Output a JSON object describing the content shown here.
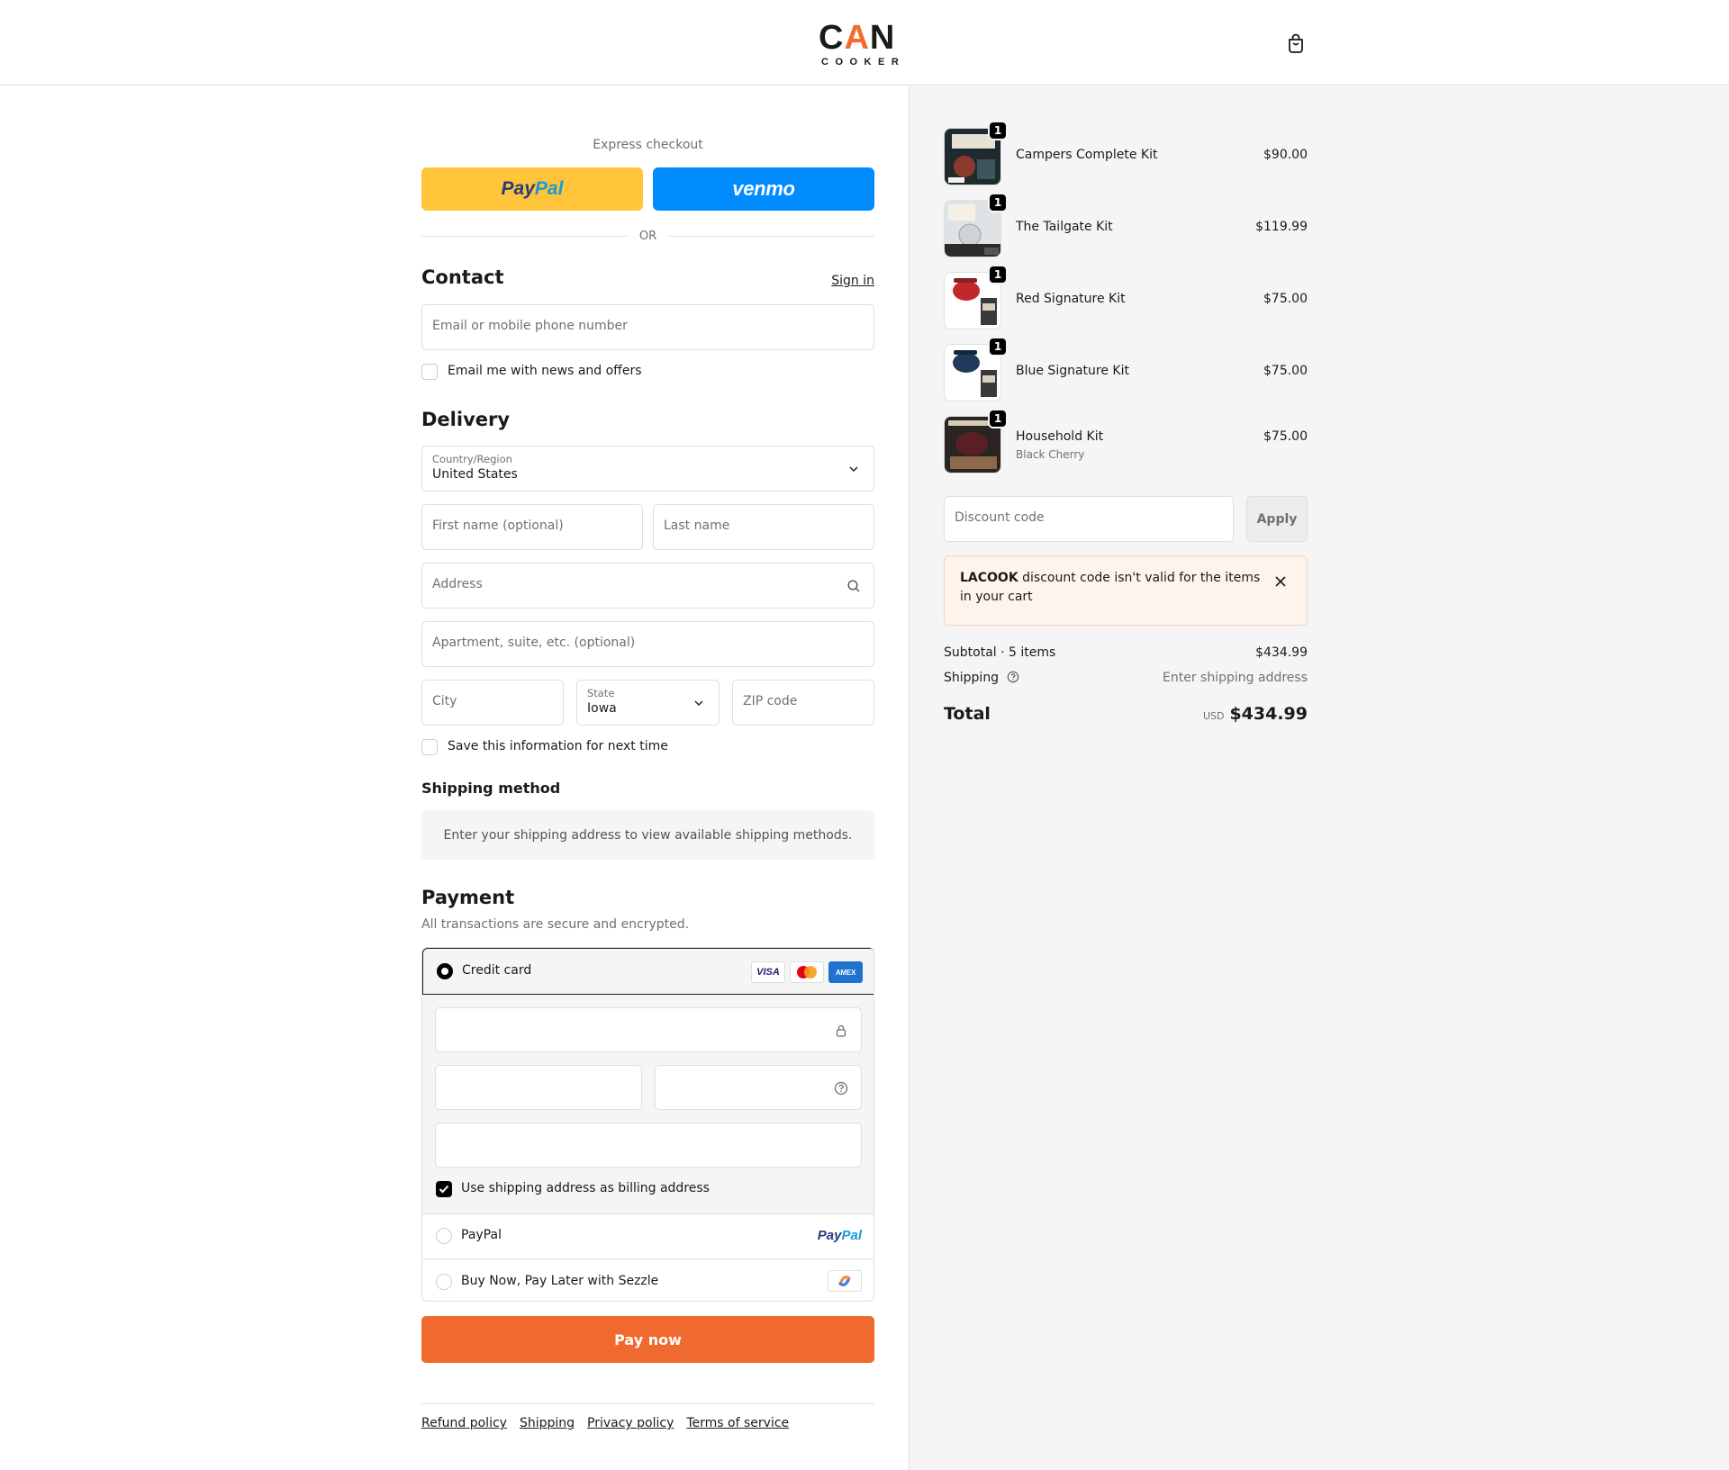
{
  "brand": {
    "name_top_1": "C",
    "name_top_2": "A",
    "name_top_3": "N",
    "name_bottom": "COOKER",
    "accent": "#f26b2f"
  },
  "express": {
    "title": "Express checkout",
    "paypal_part1": "Pay",
    "paypal_part2": "Pal",
    "venmo": "venmo",
    "or": "OR"
  },
  "contact": {
    "heading": "Contact",
    "sign_in": "Sign in",
    "email_placeholder": "Email or mobile phone number",
    "news_label": "Email me with news and offers"
  },
  "delivery": {
    "heading": "Delivery",
    "country_label": "Country/Region",
    "country_value": "United States",
    "first_name_placeholder": "First name (optional)",
    "last_name_placeholder": "Last name",
    "address_placeholder": "Address",
    "apartment_placeholder": "Apartment, suite, etc. (optional)",
    "city_placeholder": "City",
    "state_label": "State",
    "state_value": "Iowa",
    "zip_placeholder": "ZIP code",
    "save_label": "Save this information for next time"
  },
  "shipping_method": {
    "heading": "Shipping method",
    "message": "Enter your shipping address to view available shipping methods."
  },
  "payment": {
    "heading": "Payment",
    "subtitle": "All transactions are secure and encrypted.",
    "credit_card_label": "Credit card",
    "visa": "VISA",
    "amex": "AMEX",
    "billing_label": "Use shipping address as billing address",
    "billing_checked": true,
    "paypal_label": "PayPal",
    "paypal_logo_1": "Pay",
    "paypal_logo_2": "Pal",
    "sezzle_label": "Buy Now, Pay Later with Sezzle",
    "pay_now": "Pay now"
  },
  "footer": {
    "links": [
      "Refund policy",
      "Shipping",
      "Privacy policy",
      "Terms of service"
    ]
  },
  "cart": {
    "items": [
      {
        "name": "Campers Complete Kit",
        "qty": "1",
        "price": "$90.00",
        "variant": ""
      },
      {
        "name": "The Tailgate Kit",
        "qty": "1",
        "price": "$119.99",
        "variant": ""
      },
      {
        "name": "Red Signature Kit",
        "qty": "1",
        "price": "$75.00",
        "variant": ""
      },
      {
        "name": "Blue Signature Kit",
        "qty": "1",
        "price": "$75.00",
        "variant": ""
      },
      {
        "name": "Household Kit",
        "qty": "1",
        "price": "$75.00",
        "variant": "Black Cherry"
      }
    ],
    "discount_placeholder": "Discount code",
    "apply": "Apply",
    "alert_code": "LACOOK",
    "alert_text": " discount code isn't valid for the items in your cart",
    "subtotal_label": "Subtotal · 5 items",
    "subtotal_value": "$434.99",
    "shipping_label": "Shipping",
    "shipping_value": "Enter shipping address",
    "total_label": "Total",
    "total_currency": "USD",
    "total_value": "$434.99"
  },
  "colors": {
    "pay_now": "#f06a30",
    "paypal_yellow": "#ffc439",
    "venmo_blue": "#008cff"
  }
}
